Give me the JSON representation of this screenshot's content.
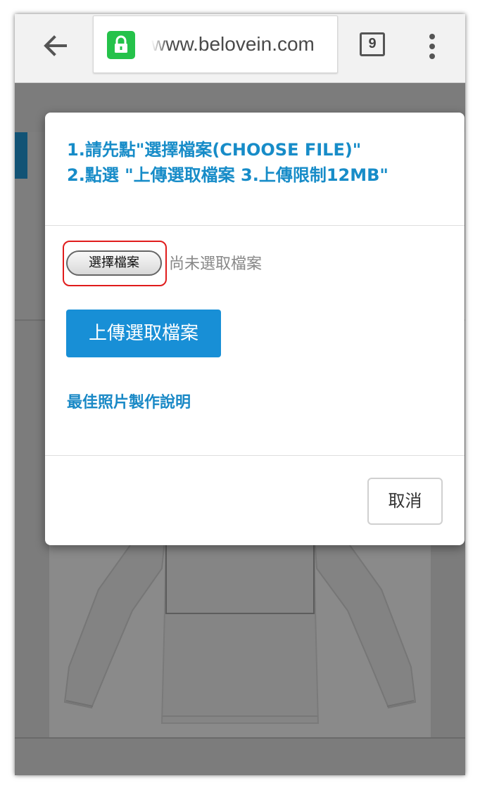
{
  "browser": {
    "url": "www.belovein.com",
    "tab_count": "9",
    "lock_color": "#25c24a"
  },
  "modal": {
    "instruction_line1": "1.請先點\"選擇檔案(CHOOSE FILE)\"",
    "instruction_line2": "2.點選 \"上傳選取檔案 3.上傳限制12MB\"",
    "choose_file_label": "選擇檔案",
    "file_status": "尚未選取檔案",
    "upload_label": "上傳選取檔案",
    "help_link": "最佳照片製作說明",
    "cancel_label": "取消"
  },
  "colors": {
    "accent_blue": "#188fd6",
    "instruction_text": "#178cc8",
    "highlight_red": "#e01c1c"
  }
}
